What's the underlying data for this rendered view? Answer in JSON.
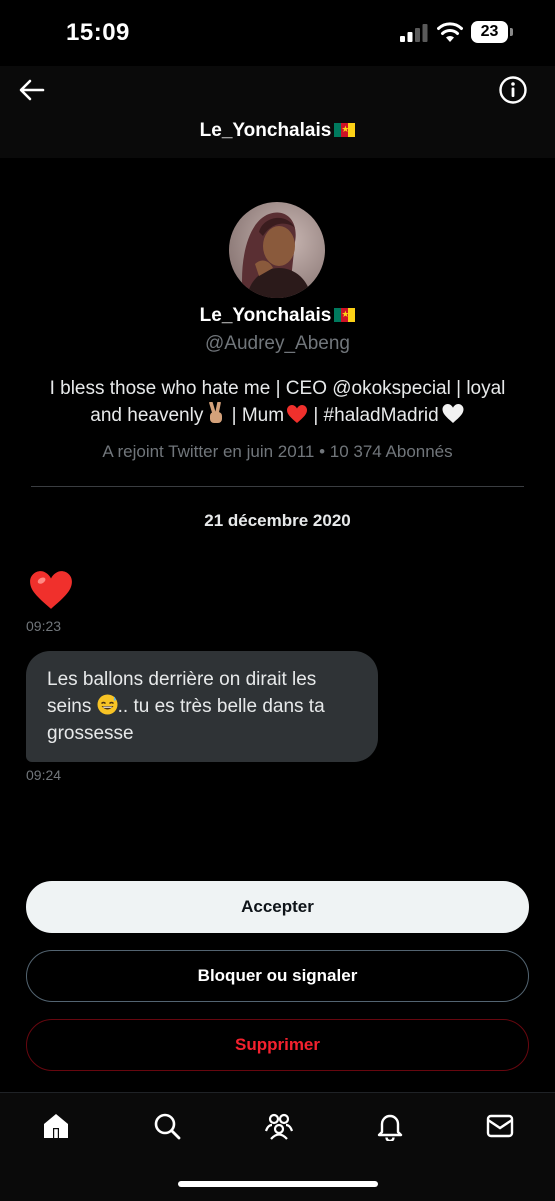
{
  "status_bar": {
    "time": "15:09",
    "battery": "23",
    "icons": [
      "cellular-signal-icon",
      "wifi-icon",
      "battery-icon"
    ]
  },
  "header": {
    "title": "Le_Yonchalais",
    "flag": "cameroon-flag-icon",
    "back_icon": "arrow-left-icon",
    "info_icon": "info-icon"
  },
  "profile": {
    "name": "Le_Yonchalais",
    "handle": "@Audrey_Abeng",
    "bio_line1": "I bless those who hate me | CEO @okokspecial | loyal",
    "bio_line2_a": "and heavenly",
    "bio_line2_b": " | Mum",
    "bio_line2_c": " | #haladMadrid",
    "joined": "A rejoint Twitter en juin 2011 • 10 374 Abonnés"
  },
  "conversation": {
    "date": "21 décembre 2020",
    "messages": [
      {
        "type": "emoji",
        "emoji": "red-heart-icon",
        "time": "09:23"
      },
      {
        "type": "text",
        "text_part1": "Les ballons derrière on dirait les seins ",
        "text_part2": ".. tu es très belle dans ta grossesse",
        "time": "09:24"
      }
    ]
  },
  "actions": {
    "accept": "Accepter",
    "block_report": "Bloquer ou signaler",
    "delete": "Supprimer"
  },
  "bottom_nav": [
    "home-icon",
    "search-icon",
    "communities-icon",
    "notifications-icon",
    "messages-icon"
  ],
  "colors": {
    "background": "#000000",
    "bubble": "#2f3336",
    "muted_text": "#71767b",
    "danger": "#f4212e",
    "accept_button": "#eff3f4"
  }
}
